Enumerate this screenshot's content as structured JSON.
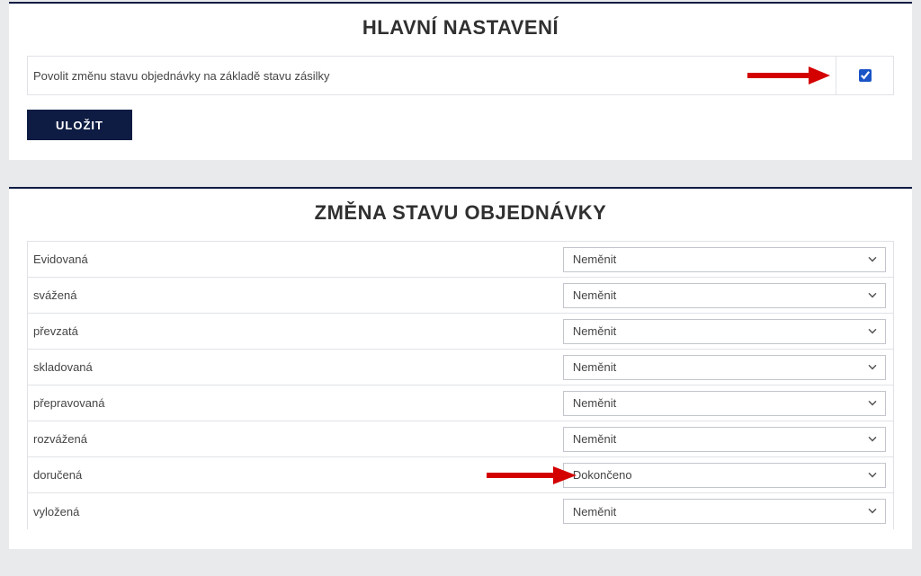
{
  "main_settings": {
    "title": "HLAVNÍ NASTAVENÍ",
    "enable_label": "Povolit změnu stavu objednávky na základě stavu zásilky",
    "enable_checked": true,
    "save_label": "ULOŽIT"
  },
  "status_change": {
    "title": "ZMĚNA STAVU OBJEDNÁVKY",
    "default_option": "Neměnit",
    "rows": [
      {
        "label": "Evidovaná",
        "value": "Neměnit"
      },
      {
        "label": "svážená",
        "value": "Neměnit"
      },
      {
        "label": "převzatá",
        "value": "Neměnit"
      },
      {
        "label": "skladovaná",
        "value": "Neměnit"
      },
      {
        "label": "přepravovaná",
        "value": "Neměnit"
      },
      {
        "label": "rozvážená",
        "value": "Neměnit"
      },
      {
        "label": "doručená",
        "value": "Dokončeno"
      },
      {
        "label": "vyložená",
        "value": "Neměnit"
      }
    ]
  },
  "annotations": {
    "arrow_color": "#d40000"
  }
}
